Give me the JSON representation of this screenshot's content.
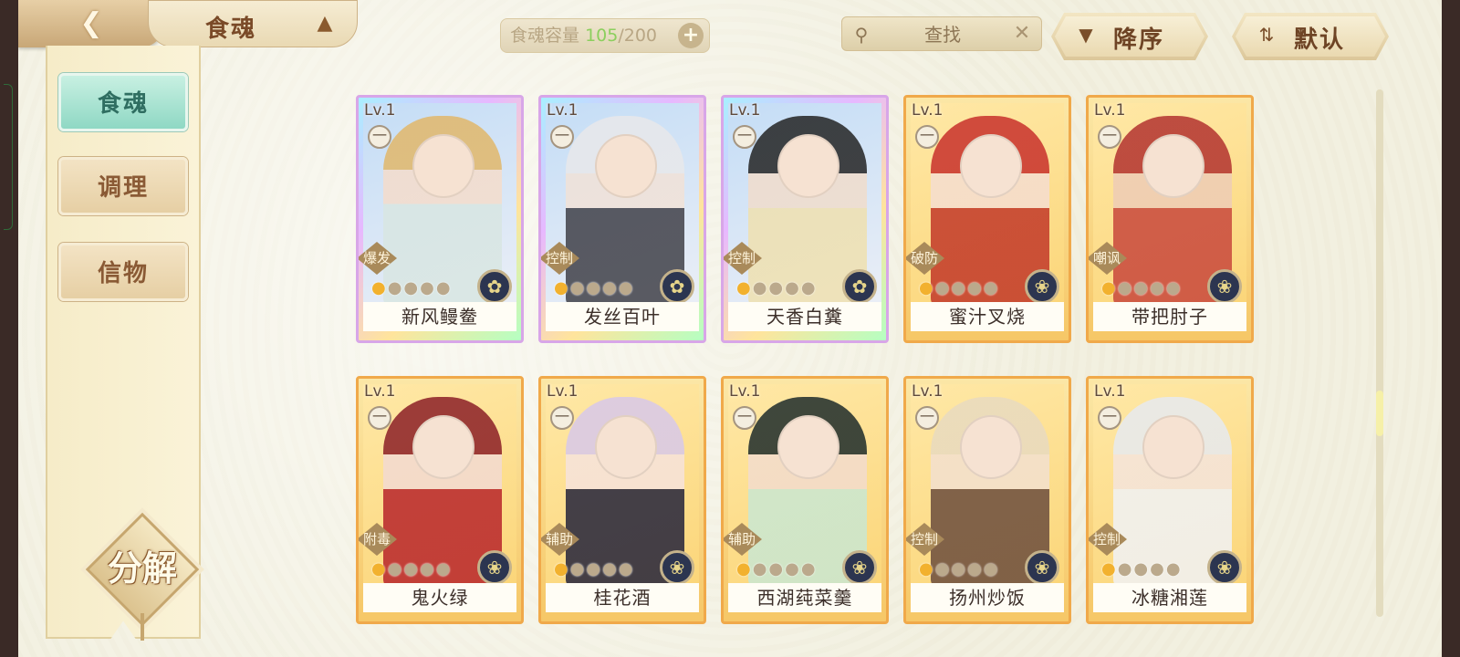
{
  "header": {
    "title": "食魂",
    "capacity_label": "食魂容量",
    "capacity_current": "105",
    "capacity_sep_max": "/200",
    "search_placeholder": "查找",
    "sort_label": "降序",
    "default_label": "默认"
  },
  "sidebar": {
    "items": [
      {
        "label": "食魂",
        "active": true
      },
      {
        "label": "调理",
        "active": false
      },
      {
        "label": "信物",
        "active": false
      }
    ],
    "decompose_label": "分解"
  },
  "cards": [
    {
      "name": "新风鳗鲞",
      "level": "Lv.1",
      "role": "爆发",
      "badge": "一",
      "stars_filled": 1,
      "stars_total": 5,
      "rarity": "UR",
      "element_icon": "flower-icon"
    },
    {
      "name": "发丝百叶",
      "level": "Lv.1",
      "role": "控制",
      "badge": "一",
      "stars_filled": 1,
      "stars_total": 5,
      "rarity": "UR",
      "element_icon": "flower-icon"
    },
    {
      "name": "天香白糞",
      "level": "Lv.1",
      "role": "控制",
      "badge": "一",
      "stars_filled": 1,
      "stars_total": 5,
      "rarity": "UR",
      "element_icon": "flower-icon"
    },
    {
      "name": "蜜汁叉烧",
      "level": "Lv.1",
      "role": "破防",
      "badge": "一",
      "stars_filled": 1,
      "stars_total": 5,
      "rarity": "SP",
      "element_icon": "flame-icon"
    },
    {
      "name": "带把肘子",
      "level": "Lv.1",
      "role": "嘲讽",
      "badge": "一",
      "stars_filled": 1,
      "stars_total": 5,
      "rarity": "SP",
      "element_icon": "flame-icon"
    },
    {
      "name": "鬼火绿",
      "level": "Lv.1",
      "role": "附毒",
      "badge": "一",
      "stars_filled": 1,
      "stars_total": 5,
      "rarity": "SP",
      "element_icon": "flame-icon"
    },
    {
      "name": "桂花酒",
      "level": "Lv.1",
      "role": "辅助",
      "badge": "一",
      "stars_filled": 1,
      "stars_total": 5,
      "rarity": "SP",
      "element_icon": "flame-icon"
    },
    {
      "name": "西湖莼菜羹",
      "level": "Lv.1",
      "role": "辅助",
      "badge": "一",
      "stars_filled": 1,
      "stars_total": 5,
      "rarity": "SP",
      "element_icon": "flame-icon"
    },
    {
      "name": "扬州炒饭",
      "level": "Lv.1",
      "role": "控制",
      "badge": "一",
      "stars_filled": 1,
      "stars_total": 5,
      "rarity": "SP",
      "element_icon": "flame-icon"
    },
    {
      "name": "冰糖湘莲",
      "level": "Lv.1",
      "role": "控制",
      "badge": "一",
      "stars_filled": 1,
      "stars_total": 5,
      "rarity": "SP",
      "element_icon": "flame-icon"
    }
  ]
}
